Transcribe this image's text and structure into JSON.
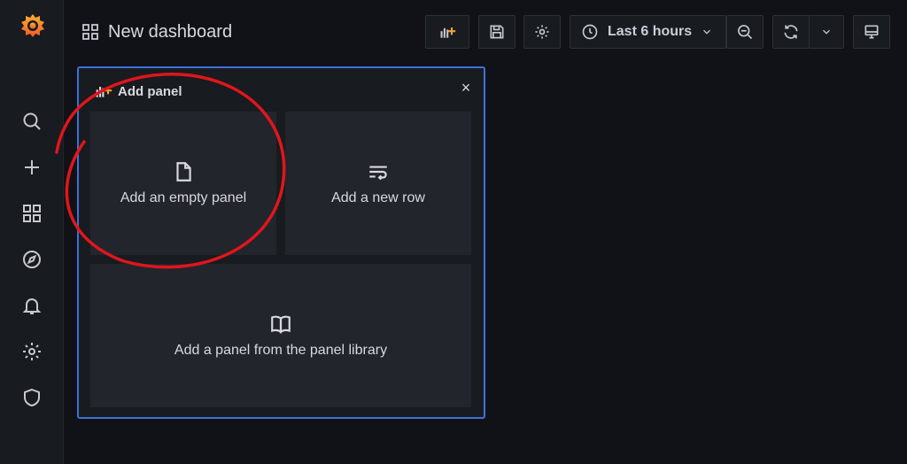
{
  "sidebar": {
    "logo": "grafana-logo",
    "items": [
      {
        "icon": "search-icon"
      },
      {
        "icon": "plus-icon"
      },
      {
        "icon": "dashboards-icon"
      },
      {
        "icon": "explore-compass-icon"
      },
      {
        "icon": "bell-icon"
      },
      {
        "icon": "gear-icon"
      },
      {
        "icon": "shield-icon"
      }
    ]
  },
  "header": {
    "title": "New dashboard",
    "time_range": "Last 6 hours"
  },
  "add_panel": {
    "title": "Add panel",
    "options": {
      "empty_panel": "Add an empty panel",
      "new_row": "Add a new row",
      "library": "Add a panel from the panel library"
    }
  },
  "colors": {
    "background": "#111217",
    "sidebar": "#181b1f",
    "card": "#22252b",
    "accent_blue": "#3d71d9",
    "logo_orange": "#f6a233",
    "annotation_red": "#e0161b"
  }
}
